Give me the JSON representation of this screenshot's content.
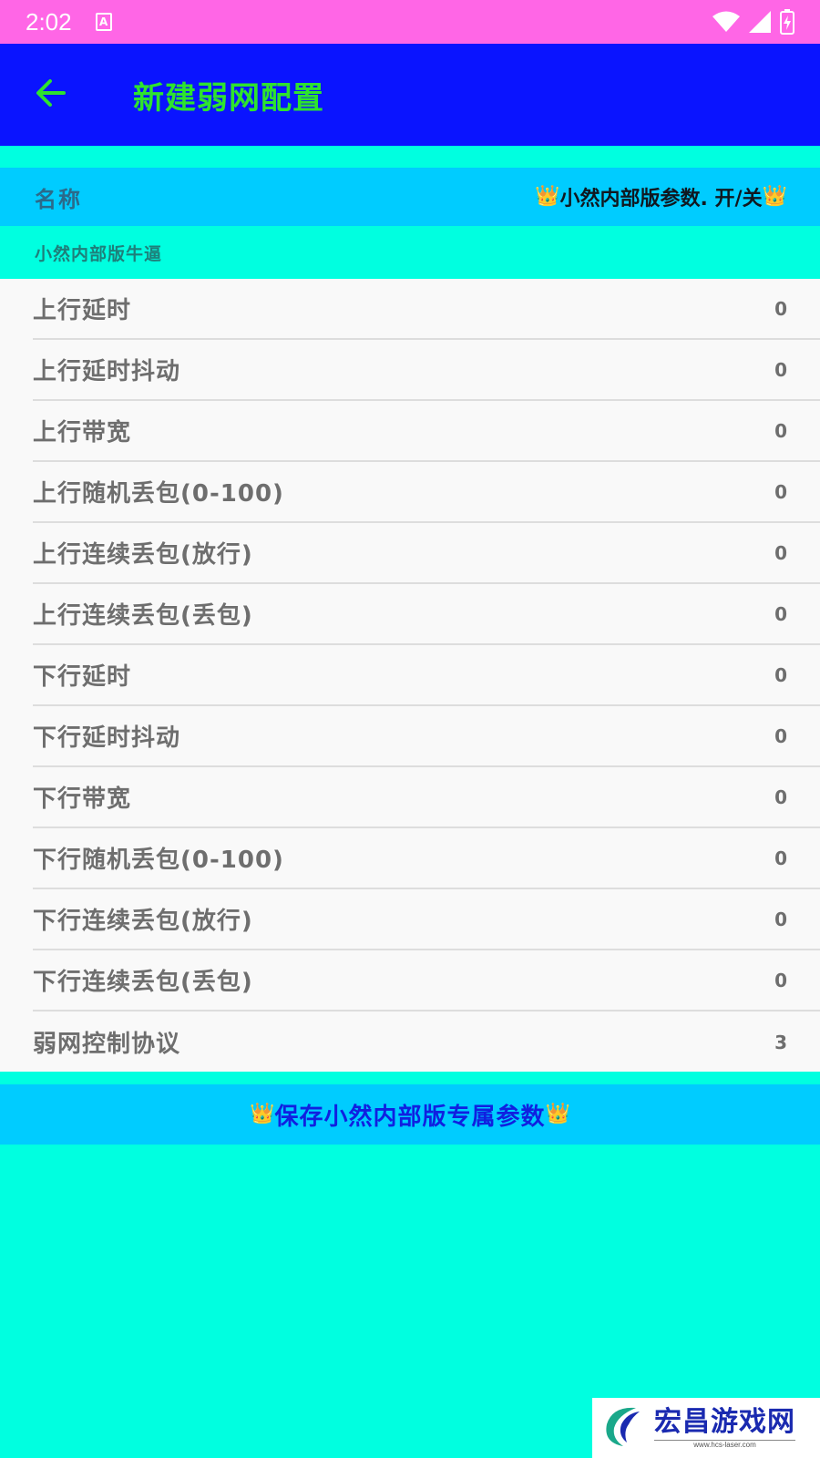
{
  "status_bar": {
    "time": "2:02",
    "a_badge": "A",
    "icons": [
      "wifi-icon",
      "cell-signal-icon",
      "battery-charging-icon"
    ]
  },
  "app_bar": {
    "title": "新建弱网配置",
    "back_icon": "arrow-left-icon"
  },
  "name_row": {
    "label": "名称",
    "toggle_text": "小然内部版参数. 开/关",
    "crown": "👑"
  },
  "name_value": "小然内部版牛逼",
  "items": [
    {
      "label": "上行延时",
      "value": "0"
    },
    {
      "label": "上行延时抖动",
      "value": "0"
    },
    {
      "label": "上行带宽",
      "value": "0"
    },
    {
      "label": "上行随机丢包(0-100)",
      "value": "0"
    },
    {
      "label": "上行连续丢包(放行)",
      "value": "0"
    },
    {
      "label": "上行连续丢包(丢包)",
      "value": "0"
    },
    {
      "label": "下行延时",
      "value": "0"
    },
    {
      "label": "下行延时抖动",
      "value": "0"
    },
    {
      "label": "下行带宽",
      "value": "0"
    },
    {
      "label": "下行随机丢包(0-100)",
      "value": "0"
    },
    {
      "label": "下行连续丢包(放行)",
      "value": "0"
    },
    {
      "label": "下行连续丢包(丢包)",
      "value": "0"
    },
    {
      "label": "弱网控制协议",
      "value": "3"
    }
  ],
  "save_button": {
    "label": "保存小然内部版专属参数",
    "crown": "👑"
  },
  "watermark": {
    "title": "宏昌游戏网",
    "url": "www.hcs-laser.com"
  },
  "colors": {
    "status_bar": "#FF66E6",
    "app_bar": "#0A14FF",
    "title": "#2EE32E",
    "section": "#00CCFF",
    "background": "#00FFE0"
  }
}
